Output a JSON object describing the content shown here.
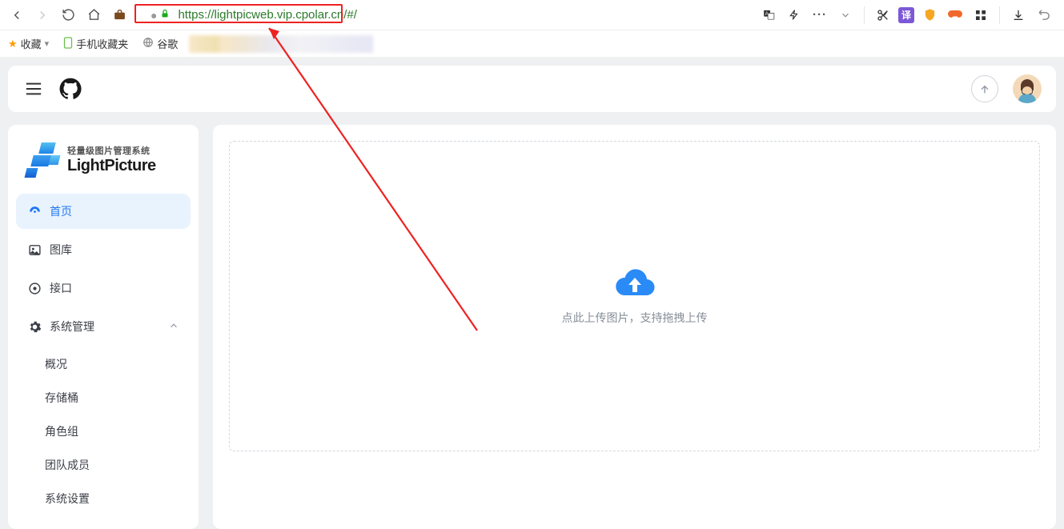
{
  "browser": {
    "url": "https://lightpicweb.vip.cpolar.cn/#/",
    "bookmarks_bar": {
      "favorites_label": "收藏",
      "mobile_label": "手机收藏夹",
      "google_label": "谷歌"
    }
  },
  "app": {
    "logo": {
      "subtitle": "轻量级图片管理系统",
      "title": "LightPicture"
    },
    "sidebar": {
      "items": [
        {
          "label": "首页",
          "icon": "dashboard-icon",
          "active": true
        },
        {
          "label": "图库",
          "icon": "image-icon"
        },
        {
          "label": "接口",
          "icon": "api-icon"
        },
        {
          "label": "系统管理",
          "icon": "settings-icon",
          "expanded": true
        }
      ],
      "sub_items": [
        {
          "label": "概况"
        },
        {
          "label": "存储桶"
        },
        {
          "label": "角色组"
        },
        {
          "label": "团队成员"
        },
        {
          "label": "系统设置"
        }
      ]
    },
    "upload": {
      "prompt": "点此上传图片，支持拖拽上传"
    }
  }
}
